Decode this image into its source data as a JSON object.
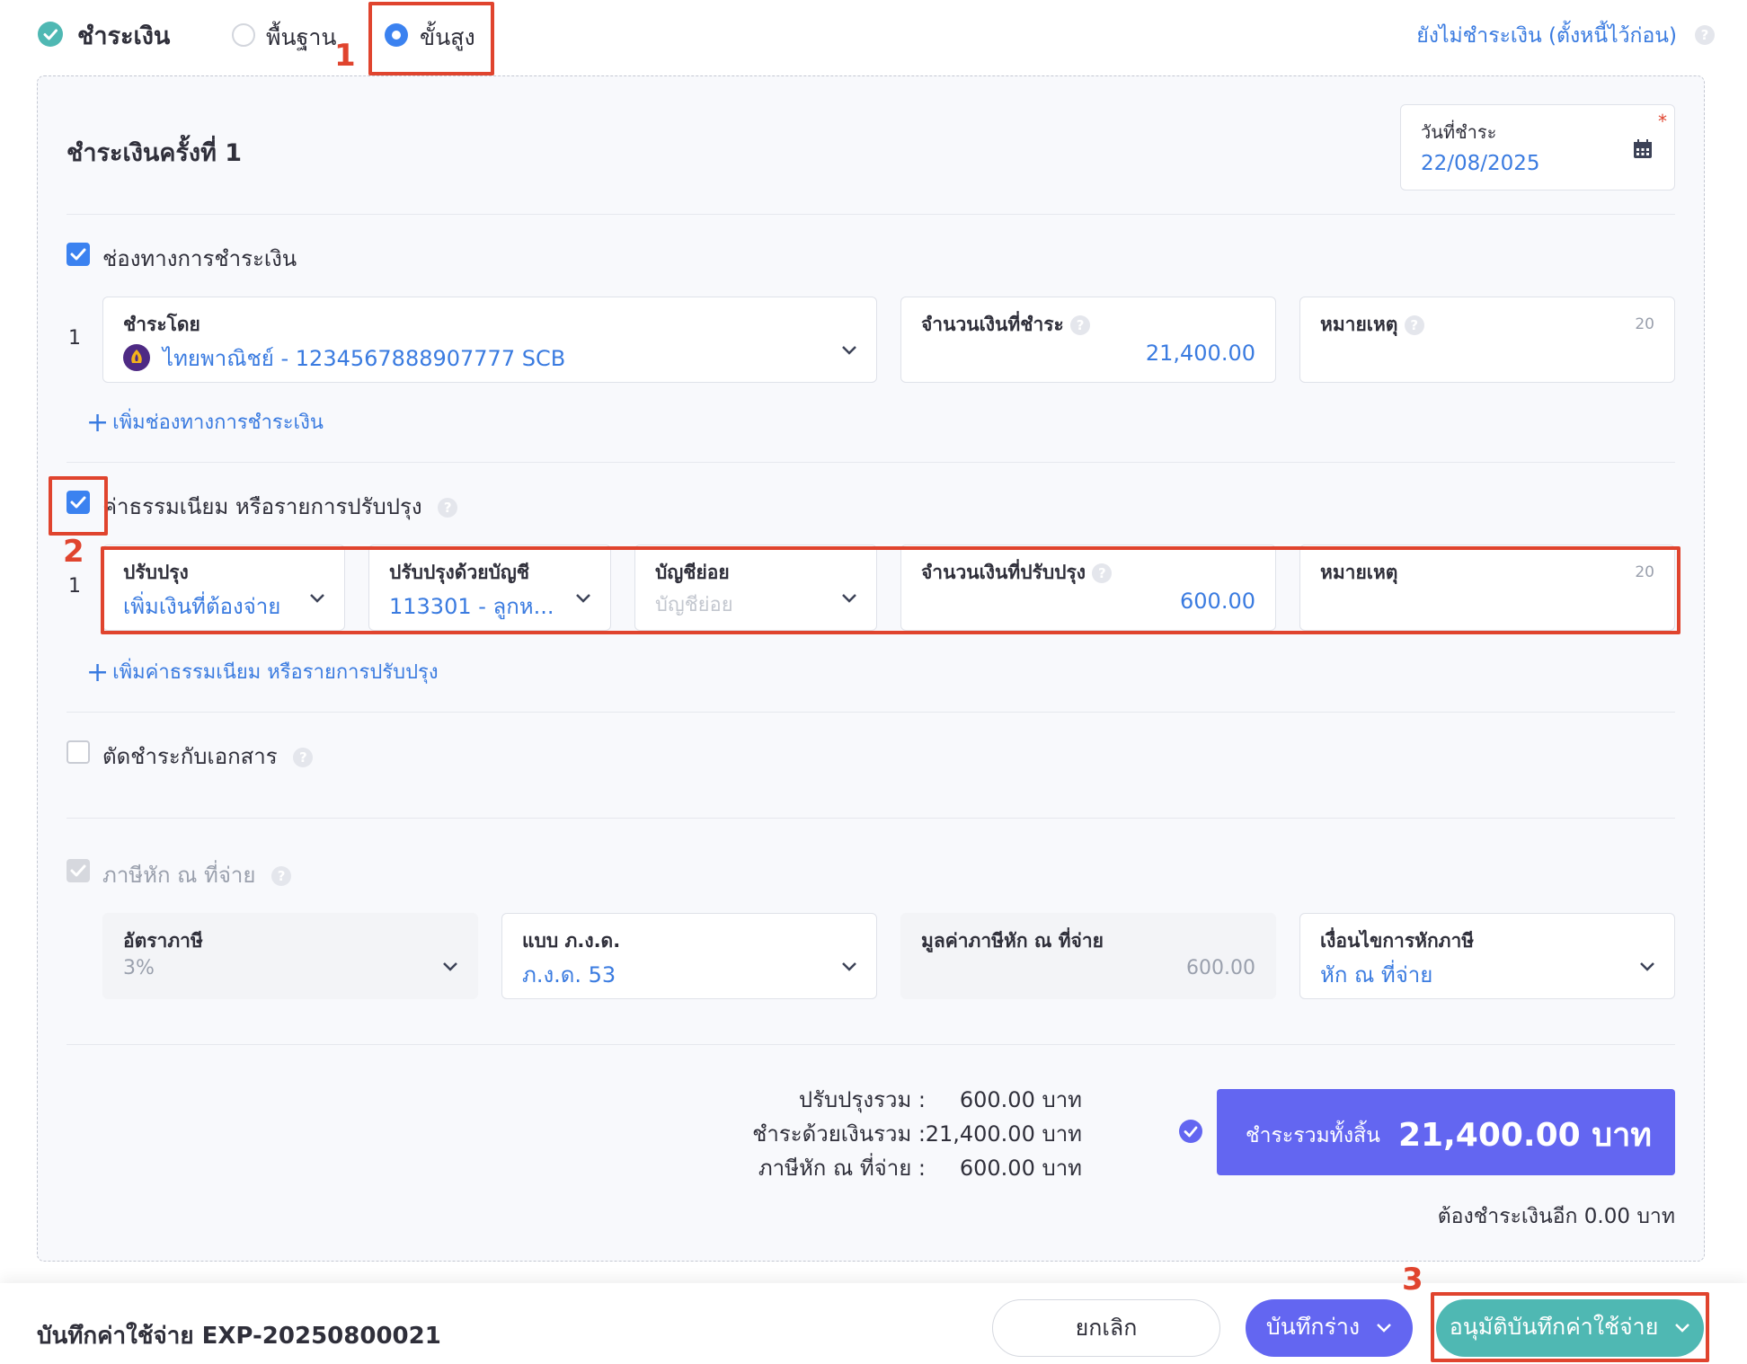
{
  "header": {
    "section_title": "ชำระเงิน",
    "mode_basic": "พื้นฐาน",
    "mode_advanced": "ขั้นสูง",
    "unpaid_link": "ยังไม่ชำระเงิน (ตั้งหนี้ไว้ก่อน)"
  },
  "payment": {
    "round_title": "ชำระเงินครั้งที่ 1",
    "date_label": "วันที่ชำระ",
    "date_required": "*",
    "date_value": "22/08/2025"
  },
  "channels": {
    "label": "ช่องทางการชำระเงิน",
    "row_no": "1",
    "pay_by_label": "ชำระโดย",
    "pay_by_value": "ไทยพาณิชย์ - 1234567888907777 SCB",
    "amount_label": "จำนวนเงินที่ชำระ",
    "amount_value": "21,400.00",
    "note_label": "หมายเหตุ",
    "note_count": "20",
    "add_label": "เพิ่มช่องทางการชำระเงิน"
  },
  "fees": {
    "label": "ค่าธรรมเนียม หรือรายการปรับปรุง",
    "row_no": "1",
    "adjust_label": "ปรับปรุง",
    "adjust_value": "เพิ่มเงินที่ต้องจ่าย",
    "account_label": "ปรับปรุงด้วยบัญชี",
    "account_value": "113301 - ลูกห...",
    "subaccount_label": "บัญชีย่อย",
    "subaccount_placeholder": "บัญชีย่อย",
    "amount_label": "จำนวนเงินที่ปรับปรุง",
    "amount_value": "600.00",
    "note_label": "หมายเหตุ",
    "note_count": "20",
    "add_label": "เพิ่มค่าธรรมเนียม หรือรายการปรับปรุง"
  },
  "offset": {
    "label": "ตัดชำระกับเอกสาร"
  },
  "wht": {
    "label": "ภาษีหัก ณ ที่จ่าย",
    "rate_label": "อัตราภาษี",
    "rate_value": "3%",
    "form_label": "แบบ ภ.ง.ด.",
    "form_value": "ภ.ง.ด. 53",
    "amount_label": "มูลค่าภาษีหัก ณ ที่จ่าย",
    "amount_value": "600.00",
    "condition_label": "เงื่อนไขการหักภาษี",
    "condition_value": "หัก ณ ที่จ่าย"
  },
  "summary": {
    "adjust_total_label": "ปรับปรุงรวม :",
    "adjust_total_value": "600.00 บาท",
    "paid_total_label": "ชำระด้วยเงินรวม :",
    "paid_total_value": "21,400.00 บาท",
    "wht_total_label": "ภาษีหัก ณ ที่จ่าย :",
    "wht_total_value": "600.00 บาท",
    "grand_label": "ชำระรวมทั้งสิ้น",
    "grand_value": "21,400.00 บาท",
    "remaining": "ต้องชำระเงินอีก 0.00 บาท"
  },
  "footer": {
    "doc_title": "บันทึกค่าใช้จ่าย EXP-20250800021",
    "cancel": "ยกเลิก",
    "save_draft": "บันทึกร่าง",
    "approve": "อนุมัติบันทึกค่าใช้จ่าย"
  },
  "annotations": {
    "step1": "1",
    "step2": "2",
    "step3": "3"
  },
  "colors": {
    "accent_blue": "#3a7be0",
    "primary_purple": "#6366f1",
    "teal": "#4fb8b3",
    "annotation_red": "#e0442e",
    "panel_bg": "#f8f9fc"
  }
}
